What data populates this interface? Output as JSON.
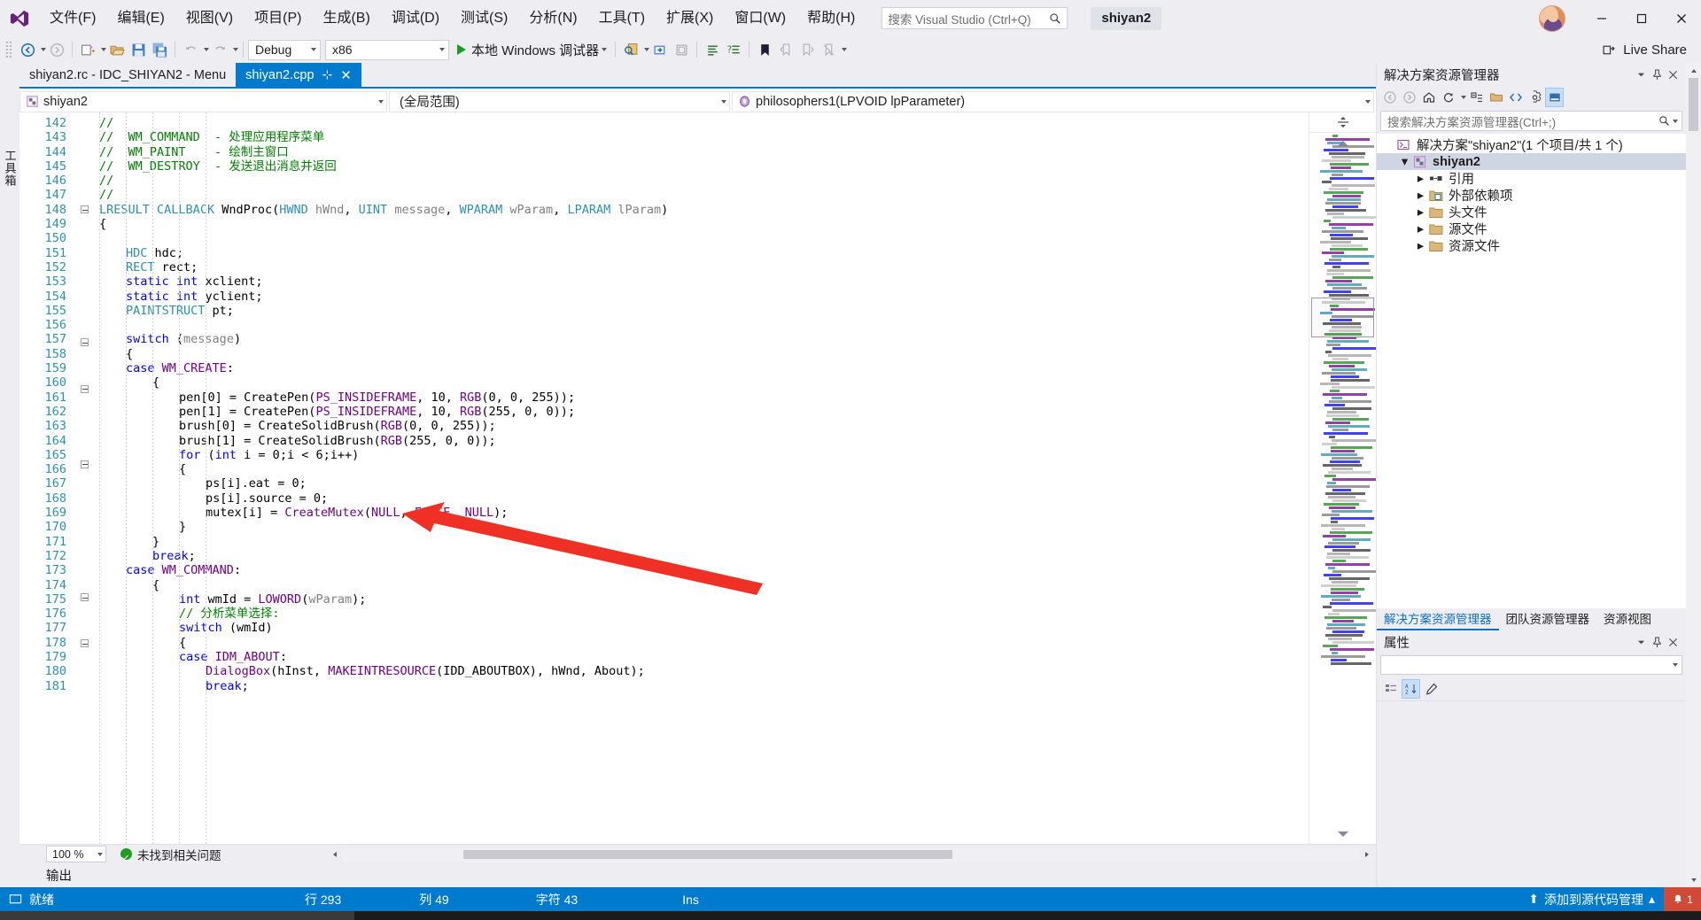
{
  "app": {
    "logo_icon": "visual-studio-logo",
    "search_placeholder": "搜索 Visual Studio (Ctrl+Q)",
    "project_chip": "shiyan2",
    "window_minimize": "—",
    "window_maximize": "□",
    "window_close": "✕"
  },
  "menu": [
    {
      "label": "文件(F)"
    },
    {
      "label": "编辑(E)"
    },
    {
      "label": "视图(V)"
    },
    {
      "label": "项目(P)"
    },
    {
      "label": "生成(B)"
    },
    {
      "label": "调试(D)"
    },
    {
      "label": "测试(S)"
    },
    {
      "label": "分析(N)"
    },
    {
      "label": "工具(T)"
    },
    {
      "label": "扩展(X)"
    },
    {
      "label": "窗口(W)"
    },
    {
      "label": "帮助(H)"
    }
  ],
  "toolbar": {
    "config": "Debug",
    "platform": "x86",
    "run_label": "本地 Windows 调试器",
    "live_share": "Live Share",
    "icons": [
      "navigate-back-icon",
      "navigate-forward-icon",
      "new-project-icon",
      "open-file-icon",
      "save-icon",
      "save-all-icon",
      "undo-icon",
      "redo-icon",
      "find-icon",
      "step-icon",
      "comment-icon",
      "uncomment-icon",
      "indent-icon",
      "outdent-icon",
      "bookmark-icon",
      "prev-bookmark-icon",
      "next-bookmark-icon",
      "clear-bookmark-icon"
    ]
  },
  "left_strip": {
    "vtab": "工具箱"
  },
  "document_tabs": [
    {
      "label": "shiyan2.rc - IDC_SHIYAN2 - Menu",
      "active": false
    },
    {
      "label": "shiyan2.cpp",
      "active": true,
      "pin": "⊹",
      "close": "✕"
    }
  ],
  "navbar": {
    "project": "shiyan2",
    "scope": "(全局范围)",
    "member": "philosophers1(LPVOID lpParameter)"
  },
  "editor": {
    "first_line": 142,
    "lines": [
      {
        "n": 142,
        "indent": 0,
        "tokens": [
          {
            "t": "//",
            "c": "cmt"
          }
        ]
      },
      {
        "n": 143,
        "indent": 0,
        "tokens": [
          {
            "t": "//  WM_COMMAND  - 处理应用程序菜单",
            "c": "cmt"
          }
        ]
      },
      {
        "n": 144,
        "indent": 0,
        "tokens": [
          {
            "t": "//  WM_PAINT    - 绘制主窗口",
            "c": "cmt"
          }
        ]
      },
      {
        "n": 145,
        "indent": 0,
        "tokens": [
          {
            "t": "//  WM_DESTROY  - 发送退出消息并返回",
            "c": "cmt"
          }
        ]
      },
      {
        "n": 146,
        "indent": 0,
        "tokens": [
          {
            "t": "//",
            "c": "cmt"
          }
        ]
      },
      {
        "n": 147,
        "indent": 0,
        "tokens": [
          {
            "t": "//",
            "c": "cmt"
          }
        ]
      },
      {
        "n": 148,
        "indent": 0,
        "fold": "minus",
        "tokens": [
          {
            "t": "LRESULT",
            "c": "type"
          },
          {
            "t": " ",
            "c": "txtc"
          },
          {
            "t": "CALLBACK",
            "c": "type"
          },
          {
            "t": " WndProc(",
            "c": "txtc"
          },
          {
            "t": "HWND",
            "c": "type"
          },
          {
            "t": " ",
            "c": "txtc"
          },
          {
            "t": "hWnd",
            "c": "par"
          },
          {
            "t": ", ",
            "c": "txtc"
          },
          {
            "t": "UINT",
            "c": "type"
          },
          {
            "t": " ",
            "c": "txtc"
          },
          {
            "t": "message",
            "c": "par"
          },
          {
            "t": ", ",
            "c": "txtc"
          },
          {
            "t": "WPARAM",
            "c": "type"
          },
          {
            "t": " ",
            "c": "txtc"
          },
          {
            "t": "wParam",
            "c": "par"
          },
          {
            "t": ", ",
            "c": "txtc"
          },
          {
            "t": "LPARAM",
            "c": "type"
          },
          {
            "t": " ",
            "c": "txtc"
          },
          {
            "t": "lParam",
            "c": "par"
          },
          {
            "t": ")",
            "c": "txtc"
          }
        ]
      },
      {
        "n": 149,
        "indent": 0,
        "tokens": [
          {
            "t": "{",
            "c": "txtc"
          }
        ]
      },
      {
        "n": 150,
        "indent": 0,
        "tokens": []
      },
      {
        "n": 151,
        "indent": 1,
        "tokens": [
          {
            "t": "HDC",
            "c": "type"
          },
          {
            "t": " hdc;",
            "c": "txtc"
          }
        ]
      },
      {
        "n": 152,
        "indent": 1,
        "tokens": [
          {
            "t": "RECT",
            "c": "type"
          },
          {
            "t": " rect;",
            "c": "txtc"
          }
        ]
      },
      {
        "n": 153,
        "indent": 1,
        "tokens": [
          {
            "t": "static",
            "c": "kw"
          },
          {
            "t": " ",
            "c": "txtc"
          },
          {
            "t": "int",
            "c": "kw"
          },
          {
            "t": " xclient;",
            "c": "txtc"
          }
        ]
      },
      {
        "n": 154,
        "indent": 1,
        "tokens": [
          {
            "t": "static",
            "c": "kw"
          },
          {
            "t": " ",
            "c": "txtc"
          },
          {
            "t": "int",
            "c": "kw"
          },
          {
            "t": " yclient;",
            "c": "txtc"
          }
        ]
      },
      {
        "n": 155,
        "indent": 1,
        "tokens": [
          {
            "t": "PAINTSTRUCT",
            "c": "type"
          },
          {
            "t": " pt;",
            "c": "txtc"
          }
        ]
      },
      {
        "n": 156,
        "indent": 0,
        "tokens": []
      },
      {
        "n": 157,
        "indent": 1,
        "fold": "minus",
        "tokens": [
          {
            "t": "switch",
            "c": "kw"
          },
          {
            "t": " (",
            "c": "txtc"
          },
          {
            "t": "message",
            "c": "par"
          },
          {
            "t": ")",
            "c": "txtc"
          }
        ]
      },
      {
        "n": 158,
        "indent": 1,
        "tokens": [
          {
            "t": "{",
            "c": "txtc"
          }
        ]
      },
      {
        "n": 159,
        "indent": 1,
        "tokens": [
          {
            "t": "case",
            "c": "kw"
          },
          {
            "t": " ",
            "c": "txtc"
          },
          {
            "t": "WM_CREATE",
            "c": "mac"
          },
          {
            "t": ":",
            "c": "txtc"
          }
        ]
      },
      {
        "n": 160,
        "indent": 2,
        "fold": "minus",
        "tokens": [
          {
            "t": "{",
            "c": "txtc"
          }
        ]
      },
      {
        "n": 161,
        "indent": 3,
        "tokens": [
          {
            "t": "pen[0] = CreatePen(",
            "c": "txtc"
          },
          {
            "t": "PS_INSIDEFRAME",
            "c": "mac"
          },
          {
            "t": ", 10, ",
            "c": "txtc"
          },
          {
            "t": "RGB",
            "c": "mac"
          },
          {
            "t": "(0, 0, 255));",
            "c": "txtc"
          }
        ]
      },
      {
        "n": 162,
        "indent": 3,
        "tokens": [
          {
            "t": "pen[1] = CreatePen(",
            "c": "txtc"
          },
          {
            "t": "PS_INSIDEFRAME",
            "c": "mac"
          },
          {
            "t": ", 10, ",
            "c": "txtc"
          },
          {
            "t": "RGB",
            "c": "mac"
          },
          {
            "t": "(255, 0, 0));",
            "c": "txtc"
          }
        ]
      },
      {
        "n": 163,
        "indent": 3,
        "tokens": [
          {
            "t": "brush[0] = CreateSolidBrush(",
            "c": "txtc"
          },
          {
            "t": "RGB",
            "c": "mac"
          },
          {
            "t": "(0, 0, 255));",
            "c": "txtc"
          }
        ]
      },
      {
        "n": 164,
        "indent": 3,
        "tokens": [
          {
            "t": "brush[1] = CreateSolidBrush(",
            "c": "txtc"
          },
          {
            "t": "RGB",
            "c": "mac"
          },
          {
            "t": "(255, 0, 0));",
            "c": "txtc"
          }
        ]
      },
      {
        "n": 165,
        "indent": 3,
        "fold": "minus",
        "tokens": [
          {
            "t": "for",
            "c": "kw"
          },
          {
            "t": " (",
            "c": "txtc"
          },
          {
            "t": "int",
            "c": "kw"
          },
          {
            "t": " i = 0;i < 6;i++)",
            "c": "txtc"
          }
        ]
      },
      {
        "n": 166,
        "indent": 3,
        "tokens": [
          {
            "t": "{",
            "c": "txtc"
          }
        ]
      },
      {
        "n": 167,
        "indent": 4,
        "tokens": [
          {
            "t": "ps[i].eat = 0;",
            "c": "txtc"
          }
        ]
      },
      {
        "n": 168,
        "indent": 4,
        "tokens": [
          {
            "t": "ps[i].source = 0;",
            "c": "txtc"
          }
        ]
      },
      {
        "n": 169,
        "indent": 4,
        "tokens": [
          {
            "t": "mutex[i] = ",
            "c": "txtc"
          },
          {
            "t": "CreateMutex",
            "c": "mac"
          },
          {
            "t": "(",
            "c": "txtc"
          },
          {
            "t": "NULL",
            "c": "mac"
          },
          {
            "t": ", ",
            "c": "txtc"
          },
          {
            "t": "FALSE",
            "c": "mac"
          },
          {
            "t": ", ",
            "c": "txtc"
          },
          {
            "t": "NULL",
            "c": "mac"
          },
          {
            "t": ");",
            "c": "txtc"
          }
        ]
      },
      {
        "n": 170,
        "indent": 3,
        "tokens": [
          {
            "t": "}",
            "c": "txtc"
          }
        ]
      },
      {
        "n": 171,
        "indent": 2,
        "tokens": [
          {
            "t": "}",
            "c": "txtc"
          }
        ]
      },
      {
        "n": 172,
        "indent": 2,
        "tokens": [
          {
            "t": "break",
            "c": "kw"
          },
          {
            "t": ";",
            "c": "txtc"
          }
        ]
      },
      {
        "n": 173,
        "indent": 1,
        "tokens": [
          {
            "t": "case",
            "c": "kw"
          },
          {
            "t": " ",
            "c": "txtc"
          },
          {
            "t": "WM_COMMAND",
            "c": "mac"
          },
          {
            "t": ":",
            "c": "txtc"
          }
        ]
      },
      {
        "n": 174,
        "indent": 2,
        "fold": "minus",
        "tokens": [
          {
            "t": "{",
            "c": "txtc"
          }
        ]
      },
      {
        "n": 175,
        "indent": 3,
        "tokens": [
          {
            "t": "int",
            "c": "kw"
          },
          {
            "t": " wmId = ",
            "c": "txtc"
          },
          {
            "t": "LOWORD",
            "c": "mac"
          },
          {
            "t": "(",
            "c": "txtc"
          },
          {
            "t": "wParam",
            "c": "par"
          },
          {
            "t": ");",
            "c": "txtc"
          }
        ]
      },
      {
        "n": 176,
        "indent": 3,
        "tokens": [
          {
            "t": "// 分析菜单选择:",
            "c": "cmt"
          }
        ]
      },
      {
        "n": 177,
        "indent": 3,
        "fold": "minus",
        "tokens": [
          {
            "t": "switch",
            "c": "kw"
          },
          {
            "t": " (wmId)",
            "c": "txtc"
          }
        ]
      },
      {
        "n": 178,
        "indent": 3,
        "tokens": [
          {
            "t": "{",
            "c": "txtc"
          }
        ]
      },
      {
        "n": 179,
        "indent": 3,
        "tokens": [
          {
            "t": "case",
            "c": "kw"
          },
          {
            "t": " ",
            "c": "txtc"
          },
          {
            "t": "IDM_ABOUT",
            "c": "mac"
          },
          {
            "t": ":",
            "c": "txtc"
          }
        ]
      },
      {
        "n": 180,
        "indent": 4,
        "tokens": [
          {
            "t": "DialogBox",
            "c": "mac"
          },
          {
            "t": "(hInst, ",
            "c": "txtc"
          },
          {
            "t": "MAKEINTRESOURCE",
            "c": "mac"
          },
          {
            "t": "(IDD_ABOUTBOX), hWnd, About);",
            "c": "txtc"
          }
        ]
      },
      {
        "n": 181,
        "indent": 4,
        "tokens": [
          {
            "t": "break",
            "c": "kw"
          },
          {
            "t": ";",
            "c": "txtc"
          }
        ]
      }
    ],
    "zoom": "100 %",
    "issues_label": "未找到相关问题",
    "issue_icon": "check-circle-icon"
  },
  "output_pane": {
    "label": "输出"
  },
  "solution_explorer": {
    "title": "解决方案资源管理器",
    "search_placeholder": "搜索解决方案资源管理器(Ctrl+;)",
    "toolbar_icons": [
      "back-icon",
      "forward-icon",
      "home-icon",
      "refresh-icon",
      "collapse-all-icon",
      "show-all-files-icon",
      "view-code-icon",
      "properties-icon",
      "sync-icon",
      "wrench-icon",
      "preview-icon"
    ],
    "tree": [
      {
        "label": "解决方案\"shiyan2\"(1 个项目/共 1 个)",
        "icon": "solution-icon",
        "depth": 0,
        "chevron": "",
        "bold": false
      },
      {
        "label": "shiyan2",
        "icon": "cpp-project-icon",
        "depth": 1,
        "chevron": "▾",
        "bold": true,
        "selected": true
      },
      {
        "label": "引用",
        "icon": "references-icon",
        "depth": 2,
        "chevron": "▸",
        "bold": false
      },
      {
        "label": "外部依赖项",
        "icon": "folder-ext-icon",
        "depth": 2,
        "chevron": "▸",
        "bold": false
      },
      {
        "label": "头文件",
        "icon": "folder-icon",
        "depth": 2,
        "chevron": "▸",
        "bold": false
      },
      {
        "label": "源文件",
        "icon": "folder-icon",
        "depth": 2,
        "chevron": "▸",
        "bold": false
      },
      {
        "label": "资源文件",
        "icon": "folder-icon",
        "depth": 2,
        "chevron": "▸",
        "bold": false
      }
    ],
    "bottom_tabs": [
      {
        "label": "解决方案资源管理器",
        "active": true
      },
      {
        "label": "团队资源管理器",
        "active": false
      },
      {
        "label": "资源视图",
        "active": false
      }
    ]
  },
  "properties": {
    "title": "属性",
    "toolbar_icons": [
      "categorized-icon",
      "alphabetical-icon",
      "property-pages-icon"
    ]
  },
  "statusbar": {
    "ready": "就绪",
    "line_label": "行 293",
    "col_label": "列 49",
    "char_label": "字符 43",
    "ins_label": "Ins",
    "source_control": "添加到源代码管理",
    "notification_count": "1",
    "up_arrow": "⬆",
    "chevron": "▴"
  },
  "colors": {
    "accent": "#007acc",
    "status_red": "#cf4b37",
    "keyword": "#0000ff",
    "type": "#2b91af",
    "macro": "#6f008a",
    "comment": "#008000",
    "arrow": "#ee3124"
  }
}
